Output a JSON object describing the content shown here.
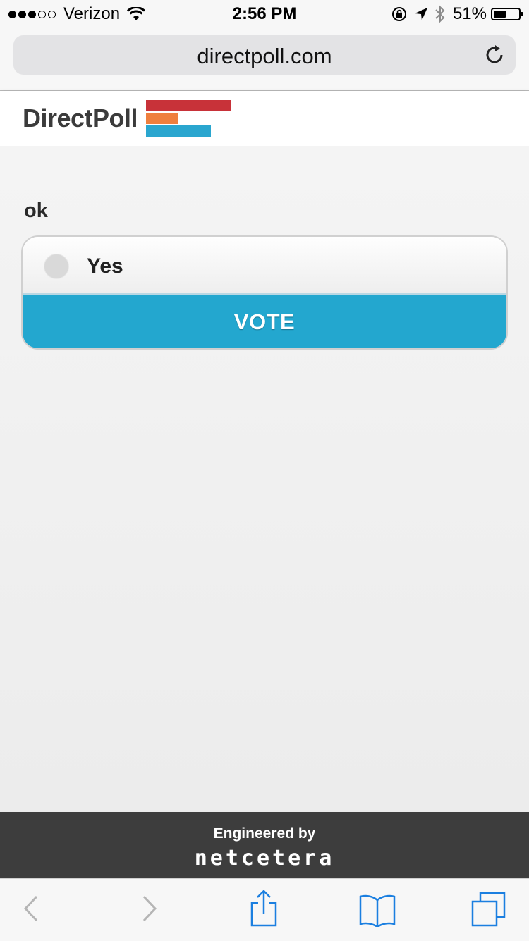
{
  "status_bar": {
    "carrier": "Verizon",
    "time": "2:56 PM",
    "battery_percent": "51%",
    "battery_level": 0.51
  },
  "browser": {
    "url": "directpoll.com"
  },
  "site": {
    "logo_text": "DirectPoll",
    "logo_colors": [
      "#c83239",
      "#ef7f3e",
      "#2aa6cf"
    ]
  },
  "poll": {
    "question": "ok",
    "options": [
      {
        "label": "Yes",
        "selected": false
      }
    ],
    "vote_label": "VOTE",
    "accent_color": "#23a7cf"
  },
  "footer": {
    "engineered_by": "Engineered by",
    "brand": "netcetera"
  },
  "toolbar": {
    "icons": [
      "back-icon",
      "forward-icon",
      "share-icon",
      "bookmarks-icon",
      "tabs-icon"
    ]
  }
}
